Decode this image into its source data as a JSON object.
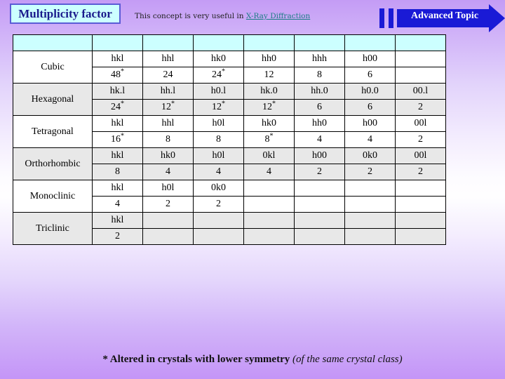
{
  "header": {
    "title": "Multiplicity factor",
    "subtitle_prefix": "This concept is very useful in ",
    "subtitle_link": "X-Ray Diffraction",
    "banner_label": "Advanced Topic"
  },
  "table": {
    "column_count": 8,
    "header_row": [
      "",
      "",
      "",
      "",
      "",
      "",
      "",
      ""
    ],
    "systems": [
      {
        "name": "Cubic",
        "shaded": false,
        "planes": [
          "hkl",
          "hhl",
          "hk0",
          "hh0",
          "hhh",
          "h00",
          ""
        ],
        "values": [
          "48",
          "24",
          "24",
          "12",
          "8",
          "6",
          ""
        ],
        "starred": [
          true,
          false,
          true,
          false,
          false,
          false,
          false
        ]
      },
      {
        "name": "Hexagonal",
        "shaded": true,
        "planes": [
          "hk.l",
          "hh.l",
          "h0.l",
          "hk.0",
          "hh.0",
          "h0.0",
          "00.l"
        ],
        "values": [
          "24",
          "12",
          "12",
          "12",
          "6",
          "6",
          "2"
        ],
        "starred": [
          true,
          true,
          true,
          true,
          false,
          false,
          false
        ]
      },
      {
        "name": "Tetragonal",
        "shaded": false,
        "planes": [
          "hkl",
          "hhl",
          "h0l",
          "hk0",
          "hh0",
          "h00",
          "00l"
        ],
        "values": [
          "16",
          "8",
          "8",
          "8",
          "4",
          "4",
          "2"
        ],
        "starred": [
          true,
          false,
          false,
          true,
          false,
          false,
          false
        ]
      },
      {
        "name": "Orthorhombic",
        "shaded": true,
        "planes": [
          "hkl",
          "hk0",
          "h0l",
          "0kl",
          "h00",
          "0k0",
          "00l"
        ],
        "values": [
          "8",
          "4",
          "4",
          "4",
          "2",
          "2",
          "2"
        ],
        "starred": [
          false,
          false,
          false,
          false,
          false,
          false,
          false
        ]
      },
      {
        "name": "Monoclinic",
        "shaded": false,
        "planes": [
          "hkl",
          "h0l",
          "0k0",
          "",
          "",
          "",
          ""
        ],
        "values": [
          "4",
          "2",
          "2",
          "",
          "",
          "",
          ""
        ],
        "starred": [
          false,
          false,
          false,
          false,
          false,
          false,
          false
        ]
      },
      {
        "name": "Triclinic",
        "shaded": true,
        "planes": [
          "hkl",
          "",
          "",
          "",
          "",
          "",
          ""
        ],
        "values": [
          "2",
          "",
          "",
          "",
          "",
          "",
          ""
        ],
        "starred": [
          false,
          false,
          false,
          false,
          false,
          false,
          false
        ]
      }
    ]
  },
  "footnote": {
    "main": "* Altered in crystals with lower symmetry ",
    "note": "(of the same crystal class)"
  },
  "colors": {
    "title_box_bg": "#ccffff",
    "title_box_border": "#5b5bd6",
    "title_text": "#1a1a8c",
    "link": "#1c7d86",
    "banner_blue": "#1a1ad6",
    "banner_text": "#ffffff",
    "table_header_bg": "#ccffff",
    "row_shaded_bg": "#e8e8e8",
    "row_plain_bg": "#ffffff",
    "background_top": "#c49cf5",
    "background_mid": "#fefeff",
    "background_bottom": "#c495f7"
  }
}
